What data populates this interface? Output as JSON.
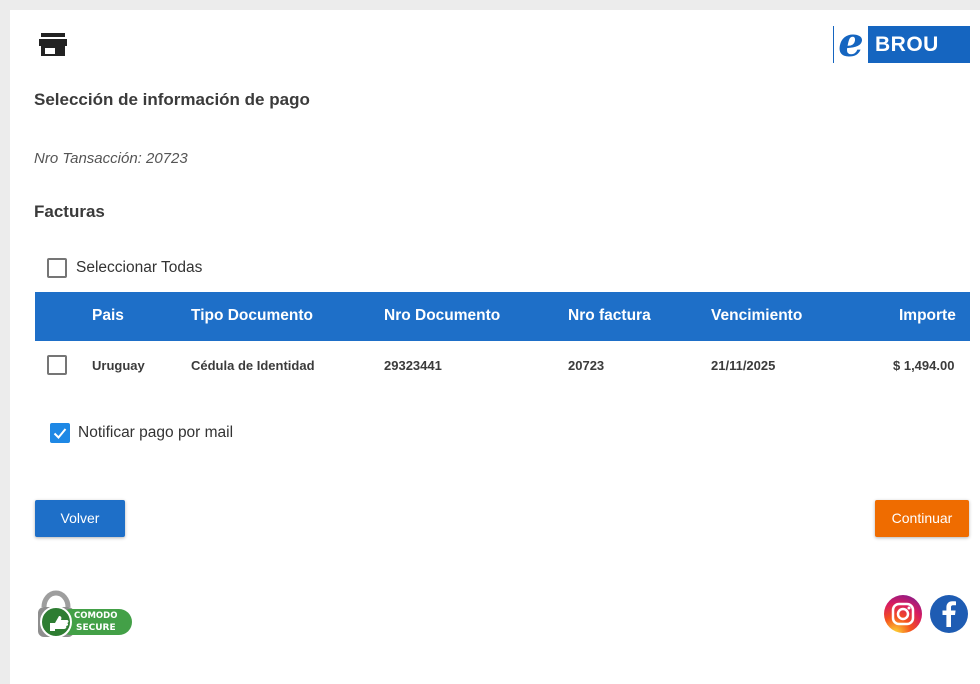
{
  "header": {
    "store_icon": "store-icon",
    "logo": {
      "letter": "e",
      "text": "BROU"
    }
  },
  "title": "Selección de información de pago",
  "transaction": "Nro Tansacción: 20723",
  "section_title": "Facturas",
  "select_all": {
    "label": "Seleccionar Todas",
    "checked": false
  },
  "table": {
    "columns": [
      "Pais",
      "Tipo Documento",
      "Nro Documento",
      "Nro factura",
      "Vencimiento",
      "Importe"
    ],
    "rows": [
      {
        "checked": false,
        "cells": [
          "Uruguay",
          "Cédula de Identidad",
          "29323441",
          "20723",
          "21/11/2025",
          "$ 1,494.00"
        ]
      }
    ]
  },
  "notify": {
    "label": "Notificar pago por mail",
    "checked": true
  },
  "buttons": {
    "back": "Volver",
    "continue": "Continuar"
  },
  "footer": {
    "seal": {
      "top": "COMODO",
      "bottom": "SECURE"
    },
    "icons": [
      "instagram-icon",
      "facebook-icon"
    ]
  },
  "colors": {
    "primary": "#1e6fc8",
    "accent": "#ef6c00",
    "check": "#1e88e5"
  }
}
